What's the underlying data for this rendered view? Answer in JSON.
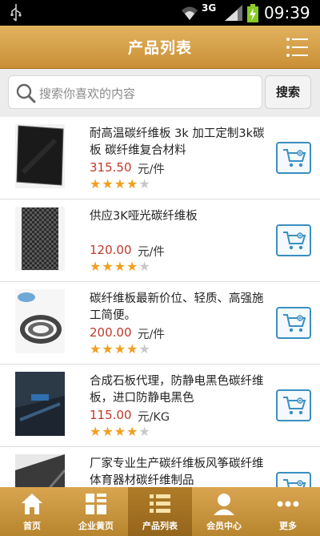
{
  "status_bar": {
    "network": "3G",
    "time": "09:39",
    "icons": [
      "usb-icon",
      "wifi-icon",
      "signal-icon",
      "battery-charging-icon"
    ]
  },
  "header": {
    "title": "产品列表",
    "menu_icon": "list-menu-icon"
  },
  "search": {
    "placeholder": "搜索你喜欢的内容",
    "button_label": "搜索"
  },
  "products": [
    {
      "name": "耐高温碳纤维板 3k 加工定制3k碳板 碳纤维复合材料",
      "price": "315.50",
      "unit": "元/件",
      "rating": 4,
      "rating_max": 5
    },
    {
      "name": "供应3K哑光碳纤维板",
      "price": "120.00",
      "unit": "元/件",
      "rating": 4,
      "rating_max": 5
    },
    {
      "name": "碳纤维板最新价位、轻质、高强施工简便。",
      "price": "200.00",
      "unit": "元/件",
      "rating": 4,
      "rating_max": 5
    },
    {
      "name": "合成石板代理，防静电黑色碳纤维板，进口防静电黑色",
      "price": "115.00",
      "unit": "元/KG",
      "rating": 4,
      "rating_max": 5
    },
    {
      "name": "厂家专业生产碳纤维板风筝碳纤维体育器材碳纤维制品",
      "price": "",
      "unit": "",
      "rating": 0,
      "rating_max": 5
    }
  ],
  "bottom_nav": [
    {
      "label": "首页",
      "icon": "home-icon",
      "active": false
    },
    {
      "label": "企业黄页",
      "icon": "grid-icon",
      "active": false
    },
    {
      "label": "产品列表",
      "icon": "list-icon",
      "active": true
    },
    {
      "label": "会员中心",
      "icon": "user-icon",
      "active": false
    },
    {
      "label": "更多",
      "icon": "more-dots-icon",
      "active": false
    }
  ],
  "colors": {
    "header": "#d6a34d",
    "price": "#c0392b",
    "star": "#f0a020",
    "cart_border": "#3a8fc0"
  }
}
